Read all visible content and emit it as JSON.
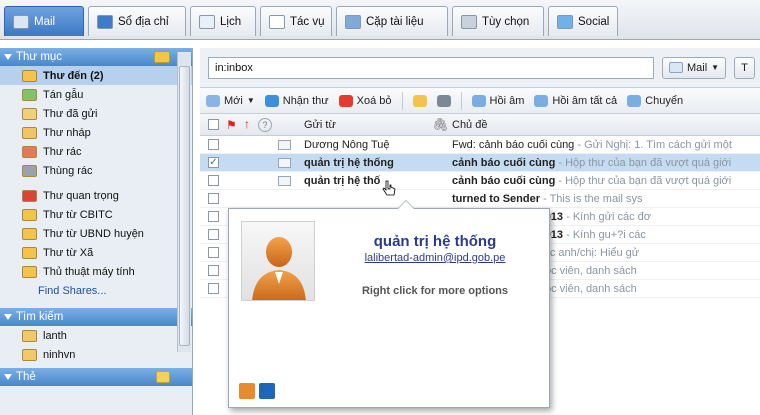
{
  "app_tabs": [
    {
      "label": "Mail",
      "icon": "mail-icon",
      "active": true
    },
    {
      "label": "Sổ địa chỉ",
      "icon": "address-book-icon"
    },
    {
      "label": "Lịch",
      "icon": "calendar-icon"
    },
    {
      "label": "Tác vụ",
      "icon": "tasks-icon"
    },
    {
      "label": "Cặp tài liệu",
      "icon": "briefcase-icon"
    },
    {
      "label": "Tùy chọn",
      "icon": "gear-icon"
    },
    {
      "label": "Social",
      "icon": "social-icon"
    }
  ],
  "sidebar": {
    "folders_title": "Thư mục",
    "folders": [
      {
        "label": "Thư đến (2)",
        "icon": "inbox-icon",
        "selected": true
      },
      {
        "label": "Tán gẫu",
        "icon": "chat-icon"
      },
      {
        "label": "Thư đã gửi",
        "icon": "sent-icon"
      },
      {
        "label": "Thư nháp",
        "icon": "drafts-icon"
      },
      {
        "label": "Thư rác",
        "icon": "junk-icon"
      },
      {
        "label": "Thùng rác",
        "icon": "trash-icon"
      },
      {
        "label": "Thư quan trọng",
        "icon": "folder-red-icon"
      },
      {
        "label": "Thư từ CBITC",
        "icon": "folder-icon"
      },
      {
        "label": "Thư từ UBND huyện",
        "icon": "folder-icon"
      },
      {
        "label": "Thư từ Xã",
        "icon": "folder-icon"
      },
      {
        "label": "Thủ thuật máy tính",
        "icon": "folder-icon"
      }
    ],
    "find_shares": "Find Shares...",
    "search_title": "Tìm kiếm",
    "searches": [
      {
        "label": "lanth",
        "icon": "saved-search-icon"
      },
      {
        "label": "ninhvn",
        "icon": "saved-search-icon"
      }
    ],
    "tags_title": "Thẻ"
  },
  "search": {
    "query": "in:inbox",
    "scope_label": "Mail",
    "scope_icon": "mail-icon",
    "next_label": "T"
  },
  "toolbar": [
    {
      "label": "Mới",
      "icon": "new-icon",
      "dropdown": true
    },
    {
      "label": "Nhận thư",
      "icon": "refresh-icon"
    },
    {
      "label": "Xoá bỏ",
      "icon": "delete-icon"
    },
    {
      "label": "",
      "icon": "move-folder-icon"
    },
    {
      "label": "",
      "icon": "print-icon"
    },
    {
      "label": "Hồi âm",
      "icon": "reply-icon"
    },
    {
      "label": "Hồi âm tất cả",
      "icon": "reply-all-icon"
    },
    {
      "label": "Chuyển",
      "icon": "forward-icon"
    }
  ],
  "columns": {
    "from": "Gửi từ",
    "subject": "Chủ đề"
  },
  "messages": [
    {
      "from": "Dương Nông Tuệ",
      "subject": "Fwd: cảnh báo cuối cùng",
      "fragment": " - Gửi Nghị: 1. Tìm cách gửi một",
      "unread": false,
      "checked": false,
      "selected": false
    },
    {
      "from": "quản trị hệ thống",
      "subject": "cảnh báo cuối cùng",
      "fragment": " - Hộp thư của bạn đã vượt quá giới",
      "unread": true,
      "checked": true,
      "selected": true
    },
    {
      "from": "quản trị hệ thố",
      "subject": "cảnh báo cuối cùng",
      "fragment": " - Hộp thư của bạn đã vượt quá giới",
      "unread": true,
      "checked": false,
      "selected": false
    },
    {
      "from": "",
      "subject": "turned to Sender",
      "fragment": " - This is the mail sys",
      "unread": true,
      "checked": false,
      "selected": false
    },
    {
      "from": "",
      "subject": "VNCSIRT DRILL 2013",
      "fragment": " - Kính gửi các đơ",
      "unread": true,
      "checked": false,
      "selected": false
    },
    {
      "from": "",
      "subject": "VNCSIRT DRILL 2013",
      "fragment": " - Kính gu+?i các",
      "unread": true,
      "checked": false,
      "selected": false
    },
    {
      "from": "",
      "subject": "u vien",
      "fragment": " - Kính gửi các anh/chị: Hiểu gử",
      "unread": true,
      "checked": false,
      "selected": false
    },
    {
      "from": "",
      "subject": "",
      "fragment": "h gửi các anh chị học viên, danh sách",
      "unread": false,
      "checked": false,
      "selected": false
    },
    {
      "from": "",
      "subject": "",
      "fragment": "h gửi các anh chị học viên, danh sách",
      "unread": false,
      "checked": false,
      "selected": false
    }
  ],
  "contact_popup": {
    "name": "quản trị hệ thống",
    "email": "lalibertad-admin@ipd.gob.pe",
    "hint": "Right click for more options",
    "footer_icons": [
      "contact-icon",
      "linkedin-icon"
    ]
  },
  "colors": {
    "accent": "#3b78c4",
    "selection": "#c5dbf2",
    "sidebar": "#e9eef4",
    "popup_name": "#2a3b8f"
  }
}
